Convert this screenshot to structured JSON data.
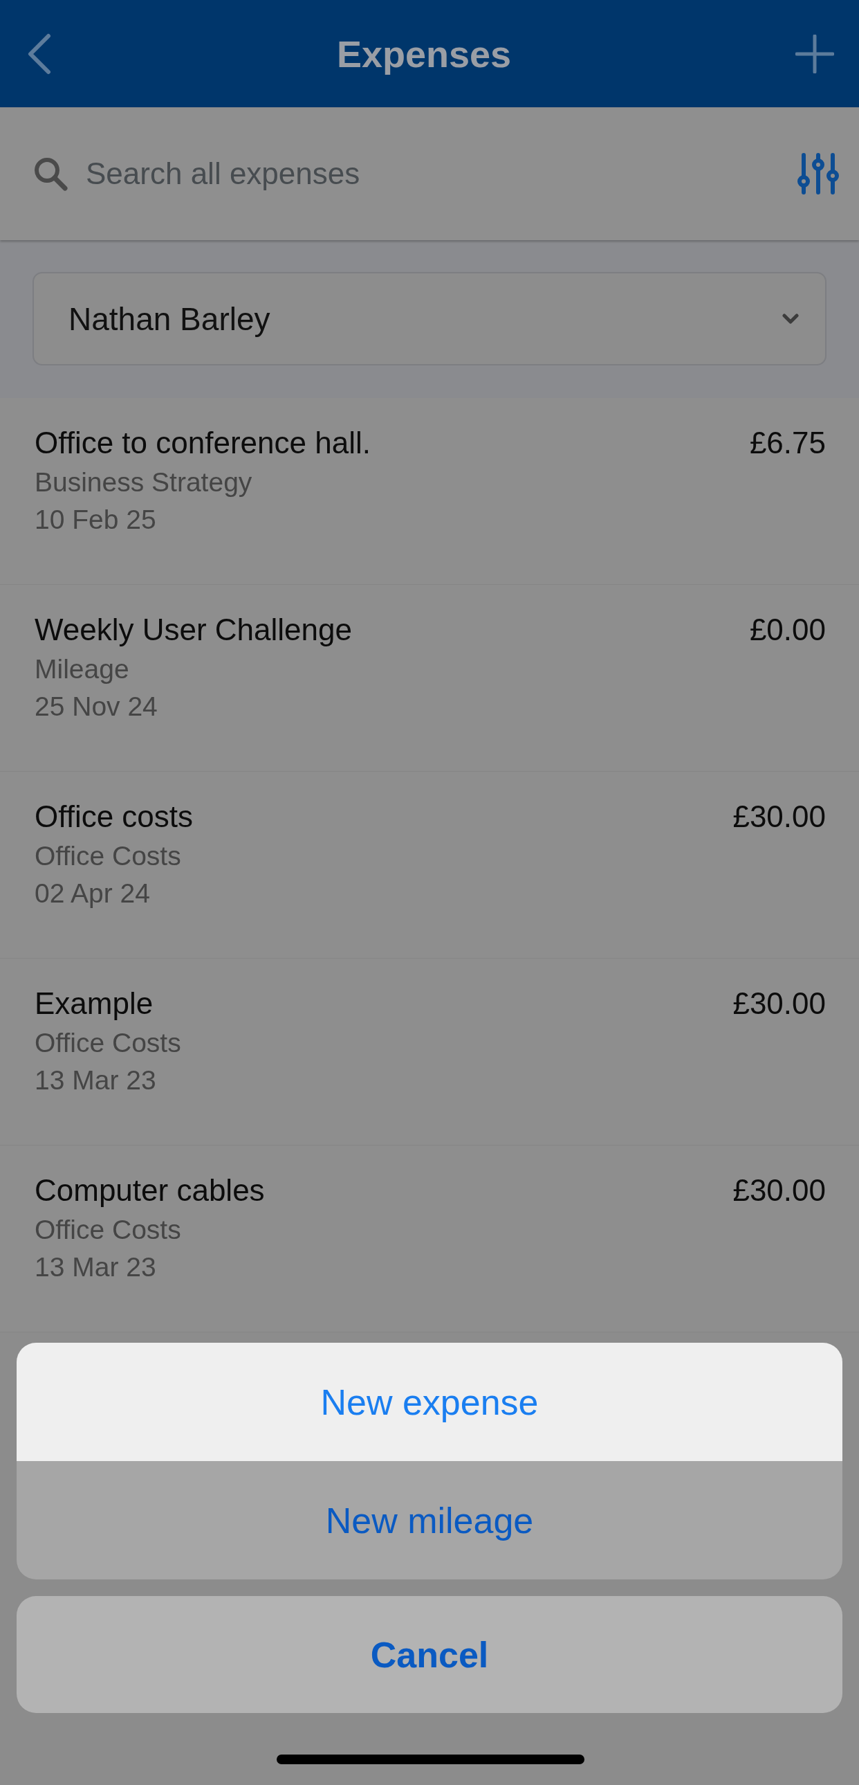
{
  "nav_bar": {
    "title": "Expenses"
  },
  "search": {
    "placeholder": "Search all expenses"
  },
  "person_select": {
    "value": "Nathan Barley"
  },
  "expenses": [
    {
      "title": "Office to conference hall.",
      "category": "Business Strategy",
      "date": "10 Feb 25",
      "amount": "£6.75"
    },
    {
      "title": "Weekly User Challenge",
      "category": "Mileage",
      "date": "25 Nov 24",
      "amount": "£0.00"
    },
    {
      "title": "Office costs",
      "category": "Office Costs",
      "date": "02 Apr 24",
      "amount": "£30.00"
    },
    {
      "title": "Example",
      "category": "Office Costs",
      "date": "13 Mar 23",
      "amount": "£30.00"
    },
    {
      "title": "Computer cables",
      "category": "Office Costs",
      "date": "13 Mar 23",
      "amount": "£30.00"
    }
  ],
  "action_sheet": {
    "options": [
      {
        "label": "New expense",
        "selected": true
      },
      {
        "label": "New mileage",
        "selected": false
      }
    ],
    "cancel": "Cancel"
  }
}
